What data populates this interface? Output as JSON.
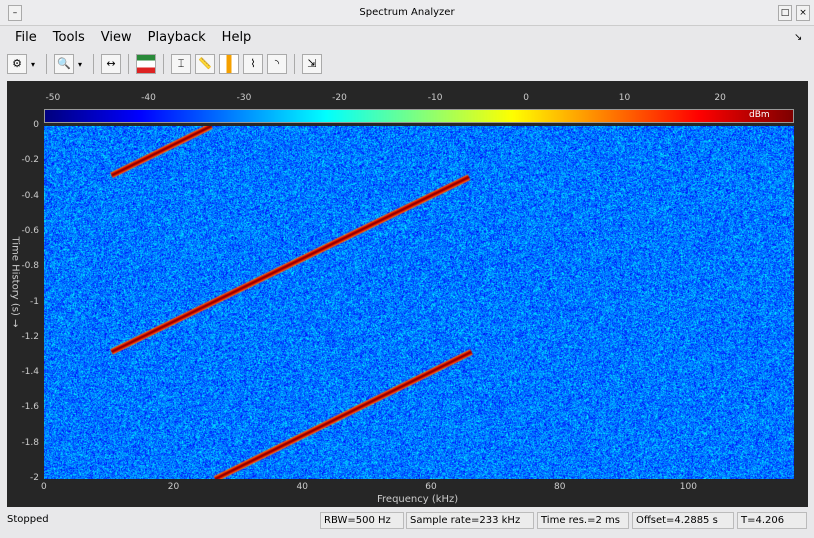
{
  "window": {
    "title": "Spectrum Analyzer"
  },
  "menu": [
    "File",
    "Tools",
    "View",
    "Playback",
    "Help"
  ],
  "toolbar": {
    "icons": [
      "settings-icon",
      "zoom-in-icon",
      "autoscale-icon",
      "spectrum-view-icon",
      "data-cursor-icon",
      "measure-icon",
      "peak-finder-icon",
      "distortion-icon",
      "ccdf-icon",
      "export-icon"
    ]
  },
  "colorbar": {
    "ticks": [
      -50,
      -40,
      -30,
      -20,
      -10,
      0,
      10,
      20
    ],
    "unit": "dBm",
    "range": [
      -51,
      27.5
    ],
    "colors": [
      "#00007f",
      "#0000ff",
      "#00ffff",
      "#ffff00",
      "#ff0000",
      "#7f0000"
    ]
  },
  "chart_data": {
    "type": "heatmap",
    "xlabel": "Frequency (kHz)",
    "ylabel": "Time History (s) →",
    "xticks": [
      0,
      20,
      40,
      60,
      80,
      100
    ],
    "yticks": [
      0,
      -0.2,
      -0.4,
      -0.6,
      -0.8,
      -1,
      -1.2,
      -1.4,
      -1.6,
      -1.8,
      -2
    ],
    "xlim": [
      0,
      116.5
    ],
    "ylim": [
      -2,
      0
    ],
    "noise_floor_dBm": -32,
    "chirps": [
      {
        "start": [
          10.5,
          -0.28
        ],
        "end": [
          26,
          0
        ]
      },
      {
        "start": [
          10.5,
          -1.28
        ],
        "end": [
          66,
          -0.29
        ]
      },
      {
        "start": [
          26.6,
          -2
        ],
        "end": [
          66.4,
          -1.28
        ]
      }
    ],
    "chirp_level_dBm": 18
  },
  "status": {
    "state": "Stopped",
    "rbw": "RBW=500 Hz",
    "sample_rate": "Sample rate=233 kHz",
    "time_res": "Time res.=2 ms",
    "offset": "Offset=4.2885 s",
    "t": "T=4.206"
  }
}
